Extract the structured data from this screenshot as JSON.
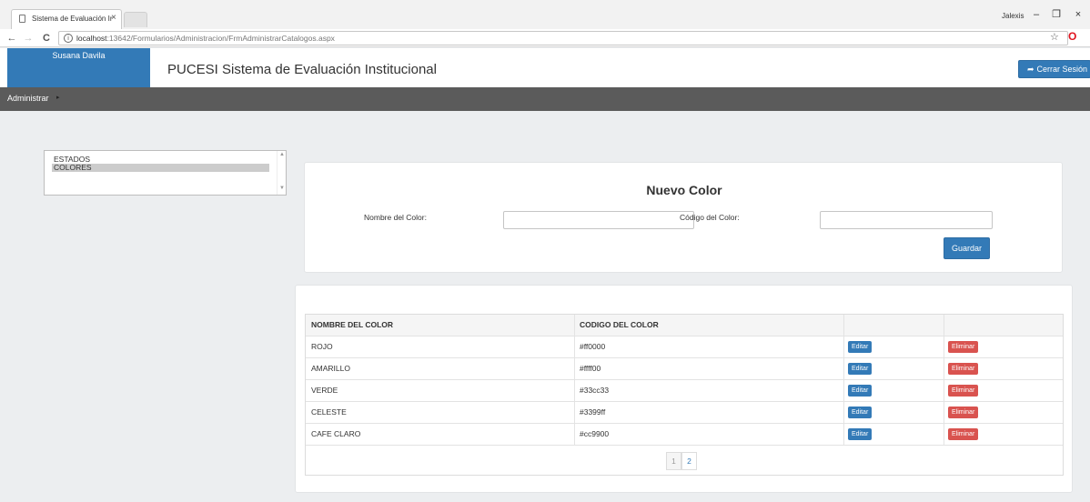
{
  "browser": {
    "tab_title": "Sistema de Evaluación Ir",
    "tab_close": "×",
    "url_host": "localhost",
    "url_rest": ":13642/Formularios/Administracion/FrmAdministrarCatalogos.aspx",
    "window_user": "Jalexis",
    "win_min": "–",
    "win_restore": "❐",
    "win_close": "×",
    "back": "←",
    "forward": "→",
    "reload": "C",
    "info": "i",
    "star": "☆",
    "opera": "O"
  },
  "header": {
    "user_name": "Susana Davila",
    "app_title": "PUCESI Sistema de Evaluación Institucional",
    "logout_label": "Cerrar Sesión",
    "logout_icon": "➦"
  },
  "menu": {
    "item": "Administrar",
    "caret": "▸"
  },
  "catalogs": {
    "options": [
      "ESTADOS",
      "COLORES"
    ],
    "selected": "COLORES",
    "scroll_up": "▲",
    "scroll_down": "▼"
  },
  "form": {
    "title": "Nuevo Color",
    "name_label": "Nombre del Color:",
    "name_value": "",
    "code_label": "Código del Color:",
    "code_value": "",
    "save_label": "Guardar"
  },
  "table": {
    "columns": [
      "NOMBRE DEL COLOR",
      "CODIGO DEL COLOR",
      "",
      ""
    ],
    "edit_label": "Editar",
    "delete_label": "Eliminar",
    "rows": [
      {
        "name": "ROJO",
        "code": "#ff0000"
      },
      {
        "name": "AMARILLO",
        "code": "#ffff00"
      },
      {
        "name": "VERDE",
        "code": "#33cc33"
      },
      {
        "name": "CELESTE",
        "code": "#3399ff"
      },
      {
        "name": "CAFE CLARO",
        "code": "#cc9900"
      }
    ],
    "pages": [
      "1",
      "2"
    ],
    "current_page": "1"
  },
  "colors": {
    "primary": "#337ab7",
    "danger": "#d9534f",
    "menubar": "#5b5b5b",
    "page_bg": "#eceef0"
  }
}
